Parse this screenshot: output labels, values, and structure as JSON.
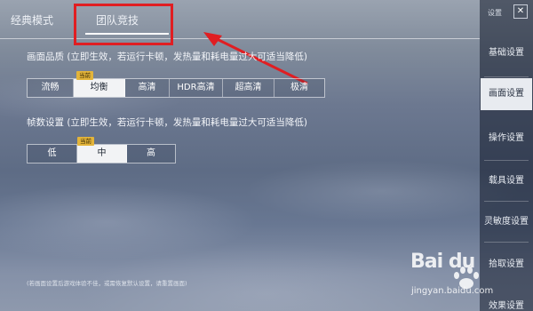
{
  "top_tabs": [
    {
      "label": "经典模式"
    },
    {
      "label": "团队竞技"
    }
  ],
  "settings": {
    "label": "设置",
    "close": "✕"
  },
  "sidebar": {
    "items": [
      {
        "label": "基础设置"
      },
      {
        "label": "画面设置"
      },
      {
        "label": "操作设置"
      },
      {
        "label": "载具设置"
      },
      {
        "label": "灵敏度设置"
      },
      {
        "label": "拾取设置"
      },
      {
        "label": "效果设置"
      }
    ],
    "active_index": 1
  },
  "quality": {
    "title": "画面品质 (立即生效，若运行卡顿，发热量和耗电量过大可适当降低)",
    "badge": "当前",
    "options": [
      "流畅",
      "均衡",
      "高清",
      "HDR高清",
      "超高清",
      "极清"
    ],
    "selected": "均衡"
  },
  "framerate": {
    "title": "帧数设置 (立即生效，若运行卡顿，发热量和耗电量过大可适当降低)",
    "badge": "当前",
    "options": [
      "低",
      "中",
      "高"
    ],
    "selected": "中"
  },
  "footnote": "(若画面设置后游戏体验不佳，或需恢复默认设置，请重置画面)",
  "watermark": {
    "brand": "Bai du",
    "url": "jingyan.baidu.com"
  },
  "colors": {
    "highlight": "#e01e22",
    "badge": "#e3b43a",
    "active_tab_bg": "#e8ebf0"
  }
}
